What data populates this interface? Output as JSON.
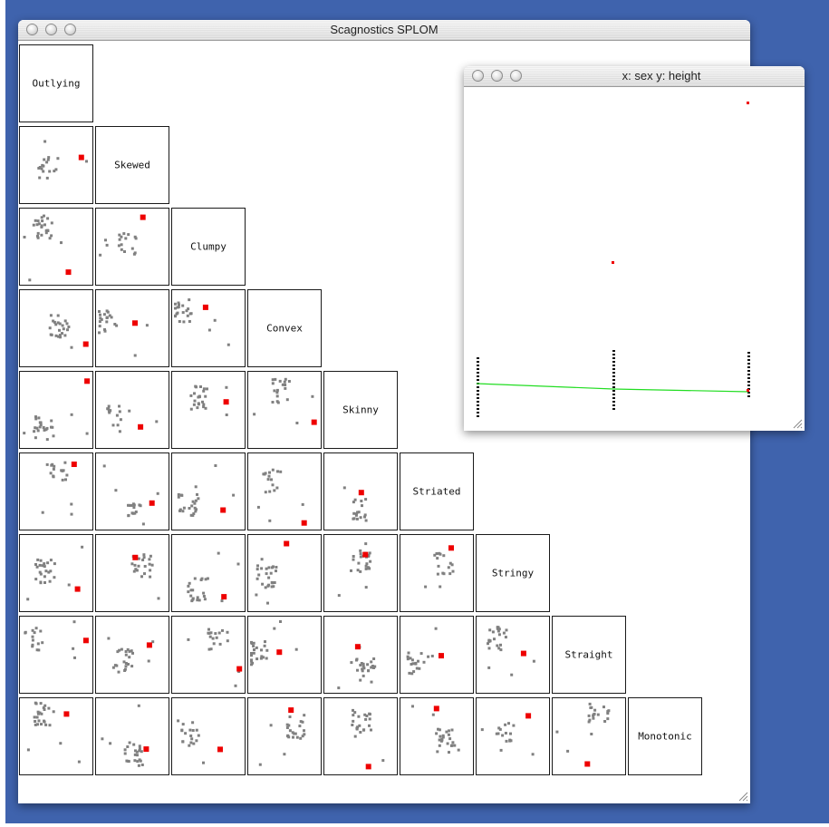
{
  "main_window": {
    "title": "Scagnostics SPLOM"
  },
  "detail_window": {
    "title": "x: sex y: height"
  },
  "splom": {
    "variables": [
      "Outlying",
      "Skewed",
      "Clumpy",
      "Convex",
      "Skinny",
      "Striated",
      "Stringy",
      "Straight",
      "Monotonic"
    ]
  },
  "colors": {
    "point_gray": "#808080",
    "highlight_red": "#ee0000",
    "fit_line_green": "#22dd22",
    "desktop_blue": "#3f63ad"
  },
  "icons": {
    "window_buttons": "traffic-light-buttons",
    "resize": "resize-grip-icon"
  }
}
